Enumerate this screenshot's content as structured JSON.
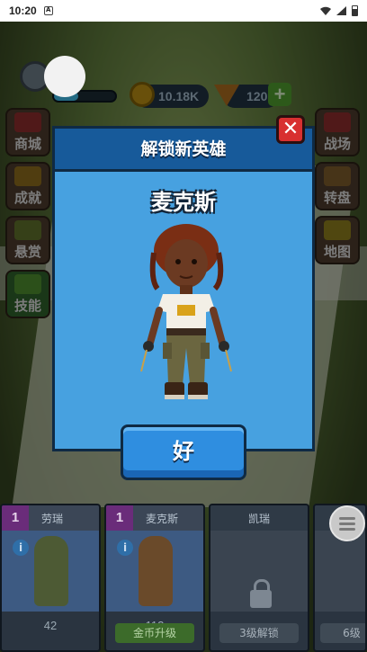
{
  "status_bar": {
    "time": "10:20",
    "notification_icon": "A"
  },
  "hud": {
    "coins": "10.18K",
    "pizza": "120",
    "plus": "+"
  },
  "side_menu_left": [
    {
      "label": "商城",
      "icon": "shop-icon"
    },
    {
      "label": "成就",
      "icon": "trophy-icon"
    },
    {
      "label": "悬赏",
      "icon": "bounty-icon"
    },
    {
      "label": "技能",
      "icon": "skill-icon"
    }
  ],
  "side_menu_right": [
    {
      "label": "战场",
      "icon": "flag-icon"
    },
    {
      "label": "转盘",
      "icon": "wheel-icon"
    },
    {
      "label": "地图",
      "icon": "crown-icon"
    }
  ],
  "dialog": {
    "title": "解锁新英雄",
    "hero_name": "麦克斯",
    "close": "✕",
    "ok_label": "好"
  },
  "hero_cards": [
    {
      "level": "1",
      "name": "劳瑞",
      "cost": "42",
      "action": ""
    },
    {
      "level": "1",
      "name": "麦克斯",
      "cost": "112",
      "action": "金币升级"
    },
    {
      "level": "",
      "name": "凯瑞",
      "cost": "",
      "action": "3级解锁"
    },
    {
      "level": "",
      "name": "",
      "cost": "",
      "action": "6级"
    }
  ],
  "colors": {
    "dialog_body": "#47a1e0",
    "dialog_header": "#175a9a",
    "close_button": "#d83030",
    "ok_button": "#2f8ee0"
  }
}
